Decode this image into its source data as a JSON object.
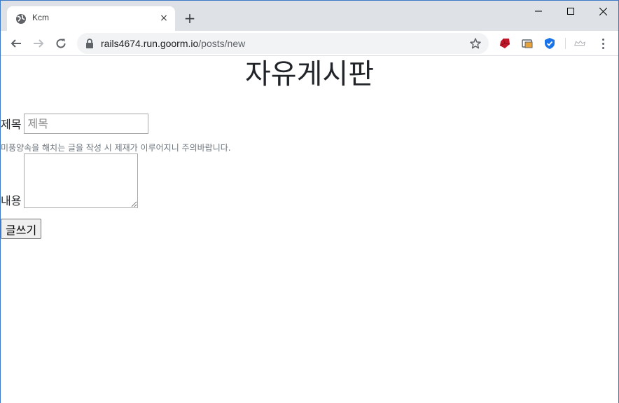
{
  "browser": {
    "tab": {
      "title": "Kcm",
      "favicon": "globe-icon",
      "close": "×"
    },
    "new_tab": "+",
    "address": {
      "host": "rails4674.run.goorm.io",
      "path": "/posts/new"
    },
    "extensions": [
      "ruby-icon",
      "cast-icon",
      "shield-icon",
      "crown-icon"
    ],
    "colors": {
      "tabstrip": "#dee1e6",
      "omnibox": "#f1f3f4",
      "shield": "#1a73e8",
      "ruby": "#c0172a"
    }
  },
  "page": {
    "heading": "자유게시판",
    "title_label": "제목",
    "title_placeholder": "제목",
    "title_value": "",
    "notice": "미풍양속을 해치는 글을 작성 시 제재가 이루어지니 주의바랍니다.",
    "body_label": "내용",
    "body_value": "",
    "submit_label": "글쓰기"
  }
}
